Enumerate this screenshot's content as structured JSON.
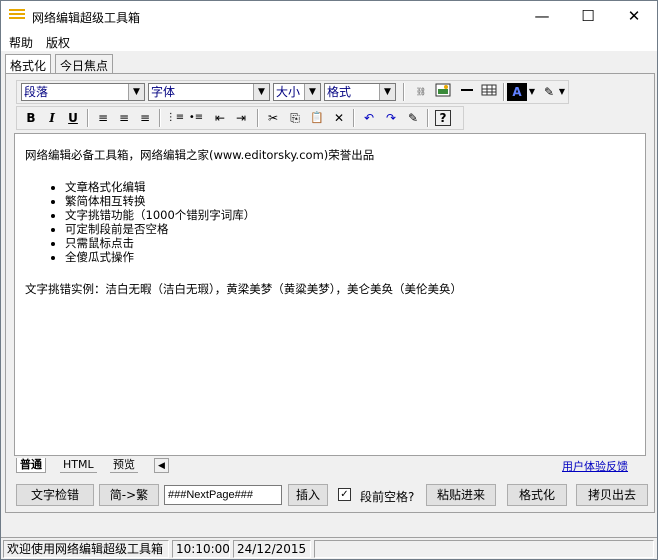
{
  "window": {
    "title": "网络编辑超级工具箱",
    "min": "—",
    "max": "☐",
    "close": "✕"
  },
  "menu": [
    "帮助",
    "版权"
  ],
  "tabs": [
    "格式化",
    "今日焦点"
  ],
  "toolbar": {
    "paragraph": "段落",
    "font": "字体",
    "size": "大小",
    "format": "格式",
    "buttons": {
      "bold": "B",
      "italic": "I",
      "underline": "U",
      "align_left": "≡",
      "align_center": "≡",
      "align_right": "≡",
      "ordered_list": "⋮≡",
      "unordered_list": "•≡",
      "outdent": "⇤",
      "indent": "⇥",
      "cut": "✂",
      "copy": "⎘",
      "paste": "📋",
      "delete": "✕",
      "undo": "↶",
      "redo": "↷",
      "edit": "✎",
      "help": "?"
    }
  },
  "editor": {
    "line1": "网络编辑必备工具箱，网络编辑之家(www.editorsky.com)荣誉出品",
    "features": [
      "文章格式化编辑",
      "繁简体相互转换",
      "文字挑错功能（1000个错别字词库）",
      "可定制段前是否空格",
      "只需鼠标点击",
      "全傻瓜式操作"
    ],
    "example": "文字挑错实例：洁白无暇（洁白无瑕），黄梁美梦（黄粱美梦），美仑美奂（美伦美奂）"
  },
  "view_tabs": [
    "普通",
    "HTML",
    "预览"
  ],
  "feedback": "用户体验反馈",
  "buttons": {
    "check": "文字检错",
    "convert": "简->繁",
    "insert": "插入",
    "space_label": "段前空格?",
    "paste_in": "粘贴进来",
    "format": "格式化",
    "copy_out": "拷贝出去"
  },
  "next_page_value": "###NextPage###",
  "space_checked": true,
  "status": {
    "welcome": "欢迎使用网络编辑超级工具箱",
    "time": "10:10:00",
    "date": "24/12/2015"
  },
  "colors": {
    "accent": "#000080",
    "link": "#0000c0",
    "icon": "#e8a800"
  }
}
